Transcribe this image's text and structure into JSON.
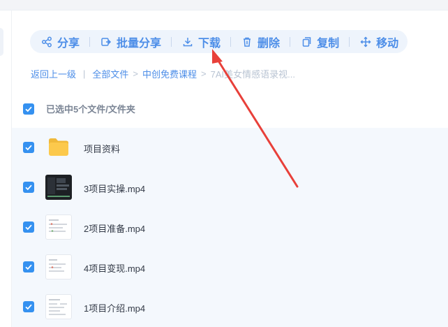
{
  "toolbar": {
    "share_label": "分享",
    "batch_share_label": "批量分享",
    "download_label": "下载",
    "delete_label": "删除",
    "copy_label": "复制",
    "move_label": "移动"
  },
  "breadcrumb": {
    "back_label": "返回上一级",
    "all_files_label": "全部文件",
    "folder1_label": "中创免费课程",
    "current_label": "7AI美女情感语录视..."
  },
  "selection": {
    "summary_label": "已选中5个文件/文件夹"
  },
  "files": [
    {
      "name": "项目资料",
      "kind": "folder",
      "checked": true
    },
    {
      "name": "3项目实操.mp4",
      "kind": "video",
      "checked": true
    },
    {
      "name": "2项目准备.mp4",
      "kind": "video",
      "checked": true
    },
    {
      "name": "4项目变现.mp4",
      "kind": "video",
      "checked": true
    },
    {
      "name": "1项目介绍.mp4",
      "kind": "video",
      "checked": true
    }
  ],
  "icons": {
    "share": "share-icon",
    "batch_share": "batch-share-icon",
    "download": "download-icon",
    "delete": "trash-icon",
    "copy": "copy-icon",
    "move": "move-icon",
    "checkbox": "checkmark-icon",
    "folder": "folder-icon"
  },
  "colors": {
    "accent": "#4d8ee8",
    "checkbox": "#3591f0",
    "toolbar_bg": "#eef4fc",
    "list_bg": "#f4f8fd",
    "folder": "#fcc94c",
    "annotation_arrow": "#e8403a"
  }
}
